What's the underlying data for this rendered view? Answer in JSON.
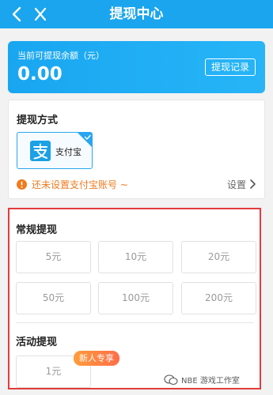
{
  "header": {
    "title": "提现中心",
    "back_icon": "back-arrow-icon",
    "close_icon": "close-icon"
  },
  "balance": {
    "label": "当前可提现余额（元）",
    "amount": "0.00",
    "record_button": "提现记录"
  },
  "method": {
    "title": "提现方式",
    "option": {
      "name": "支付宝",
      "icon": "alipay-icon",
      "selected": true
    },
    "warning": "还未设置支付宝账号 ~",
    "setting_label": "设置"
  },
  "regular": {
    "title": "常规提现",
    "options": [
      "5元",
      "10元",
      "20元",
      "50元",
      "100元",
      "200元"
    ]
  },
  "activity": {
    "title": "活动提现",
    "options": [
      "1元"
    ],
    "badge": "新人专享"
  },
  "watermark": {
    "text": "NBE 游戏工作室"
  },
  "colors": {
    "header": "#1aa5ee",
    "accent": "#29a6f0",
    "warning": "#f07a1f",
    "highlight_border": "#e33b3b",
    "badge": "#ff7d45"
  }
}
